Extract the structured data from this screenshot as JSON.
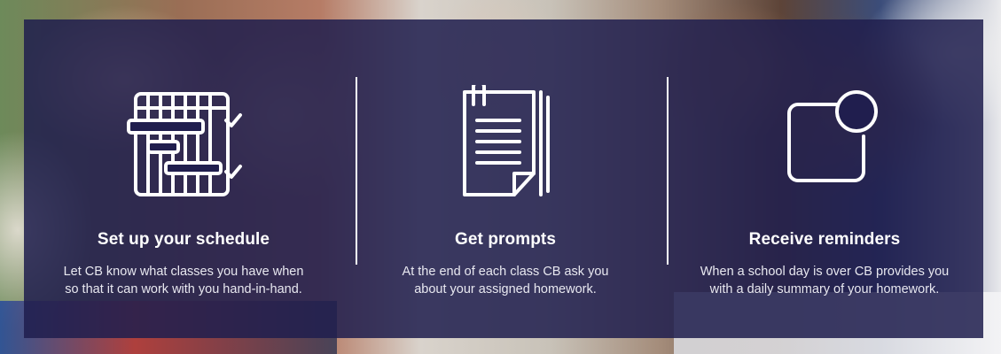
{
  "features": [
    {
      "icon": "schedule-calendar-icon",
      "title": "Set up your schedule",
      "description_line1": "Let CB know what classes you have when",
      "description_line2": "so that it can work with you hand-in-hand."
    },
    {
      "icon": "document-prompts-icon",
      "title": "Get prompts",
      "description_line1": "At the end of each class CB ask you",
      "description_line2": "about your assigned homework."
    },
    {
      "icon": "notification-reminder-icon",
      "title": "Receive reminders",
      "description_line1": "When a school day is over CB provides you",
      "description_line2": "with a daily summary of your homework."
    }
  ],
  "colors": {
    "overlay": "#201e4e",
    "text": "#ffffff",
    "divider": "#ffffff"
  }
}
